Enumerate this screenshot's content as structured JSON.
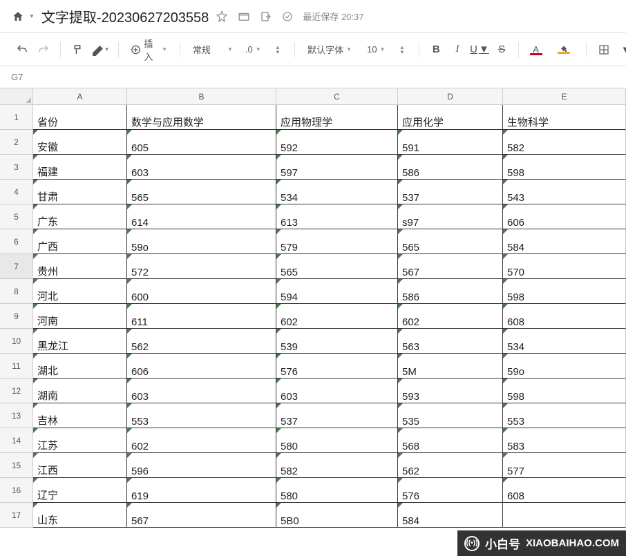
{
  "header": {
    "doc_title": "文字提取-20230627203558",
    "save_label": "最近保存",
    "save_time": "20:37"
  },
  "toolbar": {
    "insert_label": "插入",
    "format_label": "常规",
    "decimal_label": ".0",
    "font_label": "默认字体",
    "size_label": "10"
  },
  "namebox": "G7",
  "columns": [
    "A",
    "B",
    "C",
    "D",
    "E"
  ],
  "rows_numbers": [
    "1",
    "2",
    "3",
    "4",
    "5",
    "6",
    "7",
    "8",
    "9",
    "10",
    "11",
    "12",
    "13",
    "14",
    "15",
    "16",
    "17"
  ],
  "selected_row_index": 6,
  "chart_data": {
    "type": "table",
    "headers": [
      "省份",
      "数学与应用数学",
      "应用物理学",
      "应用化学",
      "生物科学"
    ],
    "rows": [
      [
        "安徽",
        "605",
        "592",
        "591",
        "582"
      ],
      [
        "福建",
        "603",
        "597",
        "586",
        "598"
      ],
      [
        "甘肃",
        "565",
        "534",
        "537",
        "543"
      ],
      [
        "广东",
        "614",
        "613",
        "s97",
        "606"
      ],
      [
        "广西",
        "59o",
        "579",
        "565",
        "584"
      ],
      [
        "贵州",
        "572",
        "565",
        "567",
        "570"
      ],
      [
        "河北",
        "600",
        "594",
        "586",
        "598"
      ],
      [
        "河南",
        "611",
        "602",
        "602",
        "608"
      ],
      [
        "黑龙江",
        "562",
        "539",
        "563",
        "534"
      ],
      [
        "湖北",
        "606",
        "576",
        "5M",
        "59o"
      ],
      [
        "湖南",
        "603",
        "603",
        "593",
        "598"
      ],
      [
        "吉林",
        "553",
        "537",
        "535",
        "553"
      ],
      [
        "江苏",
        "602",
        "580",
        "568",
        "583"
      ],
      [
        "江西",
        "596",
        "582",
        "562",
        "577"
      ],
      [
        "辽宁",
        "619",
        "580",
        "576",
        "608"
      ],
      [
        "山东",
        "567",
        "5B0",
        "584",
        ""
      ]
    ]
  },
  "watermark": {
    "cn": "小白号",
    "en": "XIAOBAIHAO.COM"
  }
}
